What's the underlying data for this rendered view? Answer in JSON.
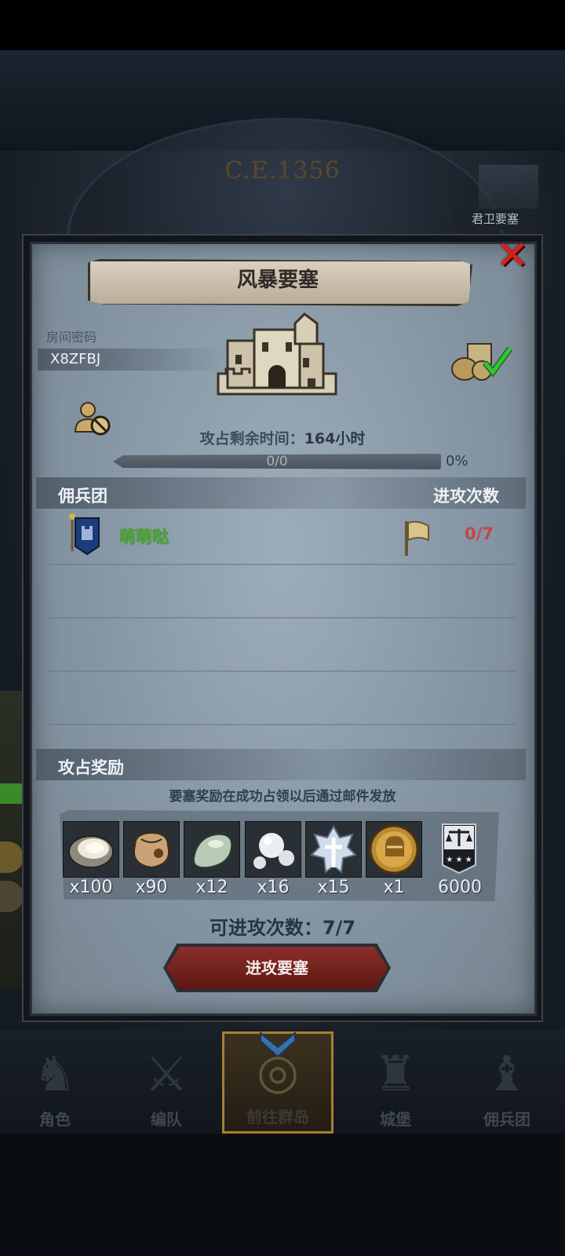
{
  "background": {
    "year_label": "C.E.1356",
    "corner_label": "君卫要塞"
  },
  "dialog": {
    "title": "风暴要塞",
    "close_icon": "close-icon",
    "room_password_label": "房间密码",
    "room_password_value": "X8ZFBJ",
    "time_label": "攻占剩余时间：",
    "time_value": "164",
    "time_unit": "小时",
    "progress_text": "0/0",
    "progress_percent": "0%",
    "progress_fraction": 0
  },
  "mercenary_section": {
    "header_left": "佣兵团",
    "header_right": "进攻次数",
    "rows": [
      {
        "name": "萌萌哒",
        "attacks": "0/7"
      }
    ]
  },
  "reward_section": {
    "header": "攻占奖励",
    "note": "要塞奖励在成功占领以后通过邮件发放",
    "items": [
      {
        "icon": "oyster-icon",
        "qty": "x100"
      },
      {
        "icon": "sack-icon",
        "qty": "x90"
      },
      {
        "icon": "jade-stone-icon",
        "qty": "x12"
      },
      {
        "icon": "pearls-icon",
        "qty": "x16"
      },
      {
        "icon": "crystal-icon",
        "qty": "x15"
      },
      {
        "icon": "knight-coin-icon",
        "qty": "x1"
      },
      {
        "icon": "justice-banner-icon",
        "qty": "6000"
      }
    ]
  },
  "attack_count_label": "可进攻次数：",
  "attack_count_value": "7/7",
  "attack_button_label": "进攻要塞",
  "bottom_nav": [
    {
      "label": "角色",
      "icon": "character-icon"
    },
    {
      "label": "编队",
      "icon": "formation-icon"
    },
    {
      "label": "前往群岛",
      "icon": "islands-icon",
      "active": true
    },
    {
      "label": "城堡",
      "icon": "castle-icon"
    },
    {
      "label": "佣兵团",
      "icon": "mercenary-icon"
    }
  ],
  "colors": {
    "merc_name": "#4caa2c",
    "attack_count_red": "#c34545",
    "close_red": "#d8211c",
    "button_red": "#8a2f2a",
    "nav_active_border": "#a5812e"
  }
}
